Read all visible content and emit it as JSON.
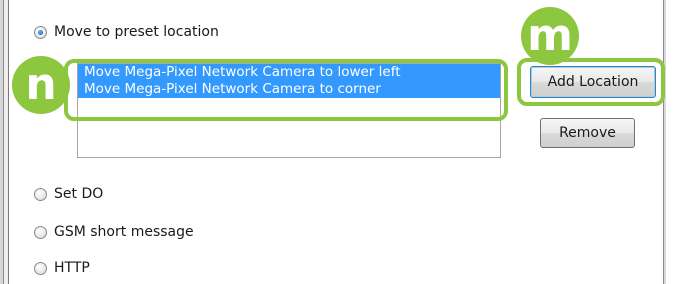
{
  "options": {
    "preset": "Move to preset location",
    "set_do": "Set DO",
    "gsm": "GSM short message",
    "http": "HTTP"
  },
  "locations": [
    "Move Mega-Pixel Network Camera to lower left",
    "Move Mega-Pixel Network Camera to corner"
  ],
  "buttons": {
    "add_location": "Add Location",
    "remove": "Remove"
  },
  "callouts": {
    "n": "n",
    "m": "m"
  },
  "colors": {
    "callout": "#8dc63f",
    "selection": "#3399ff"
  }
}
